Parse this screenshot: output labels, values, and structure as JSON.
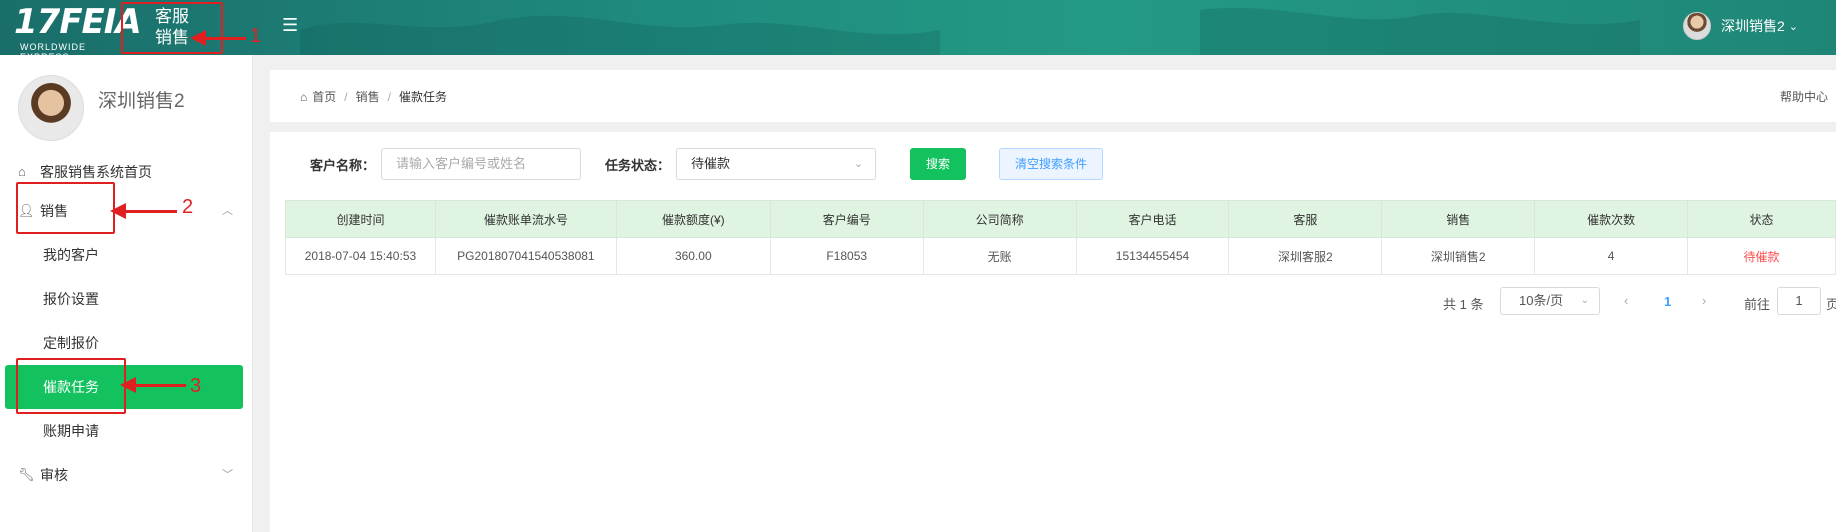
{
  "header": {
    "logo_main": "17FEIA",
    "logo_sub": "WORLDWIDE EXPRESS",
    "system_title": "客服 销售",
    "menu_icon": "hamburger-icon",
    "user_name": "深圳销售2"
  },
  "sidebar": {
    "profile_name": "深圳销售2",
    "items": [
      {
        "label": "客服销售系统首页",
        "icon": "home-icon"
      },
      {
        "label": "销售",
        "icon": "user-icon",
        "expanded": true
      },
      {
        "label": "我的客户"
      },
      {
        "label": "报价设置"
      },
      {
        "label": "定制报价"
      },
      {
        "label": "催款任务",
        "active": true
      },
      {
        "label": "账期申请"
      },
      {
        "label": "审核",
        "icon": "wrench-icon",
        "expanded": false
      }
    ]
  },
  "breadcrumb": {
    "home": "首页",
    "section": "销售",
    "current": "催款任务",
    "separator": "/",
    "help": "帮助中心"
  },
  "filter": {
    "customer_label": "客户名称：",
    "customer_placeholder": "请输入客户编号或姓名",
    "status_label": "任务状态：",
    "status_value": "待催款",
    "search_button": "搜索",
    "clear_button": "清空搜索条件"
  },
  "table": {
    "headers": [
      "创建时间",
      "催款账单流水号",
      "催款额度(¥)",
      "客户编号",
      "公司简称",
      "客户电话",
      "客服",
      "销售",
      "催款次数",
      "状态"
    ],
    "rows": [
      [
        "2018-07-04 15:40:53",
        "PG201807041540538081",
        "360.00",
        "F18053",
        "无账",
        "15134455454",
        "深圳客服2",
        "深圳销售2",
        "4",
        "待催款"
      ]
    ]
  },
  "pagination": {
    "total": "共 1 条",
    "page_size": "10条/页",
    "current_page": "1",
    "goto_label": "前往",
    "goto_value": "1",
    "goto_suffix": "页"
  },
  "annotations": {
    "n1": "1",
    "n2": "2",
    "n3": "3"
  },
  "colors": {
    "accent_green": "#13c25f",
    "table_header_bg": "#dff4e1",
    "status_red": "#ff4d4f",
    "link_blue": "#409eff",
    "annotation_red": "#e02020"
  }
}
